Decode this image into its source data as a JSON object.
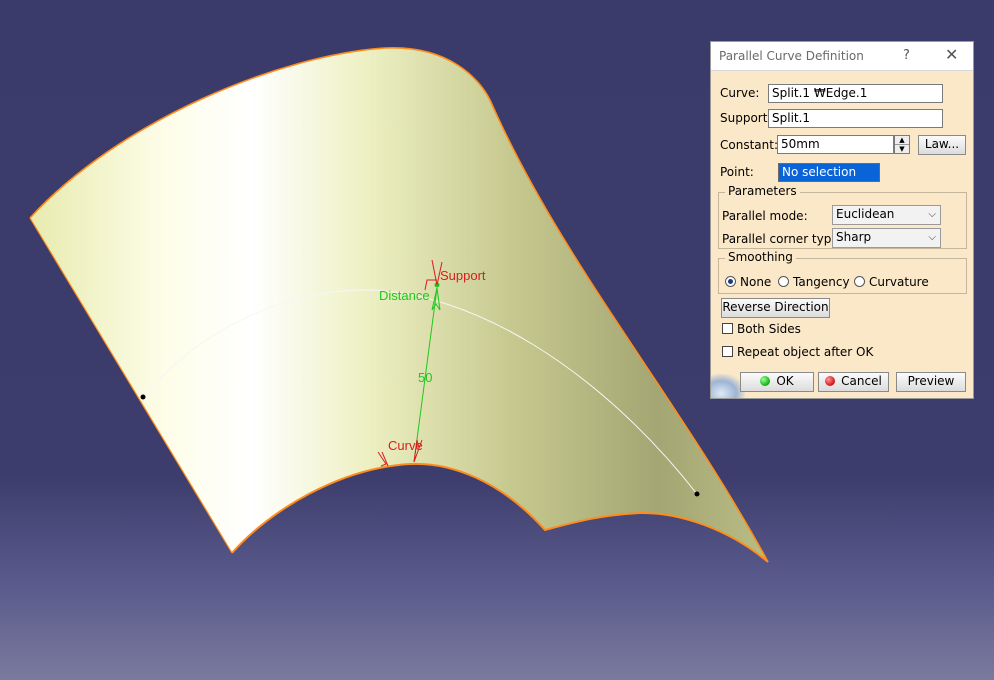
{
  "viewport": {
    "labels": {
      "support": "Support",
      "distance": "Distance",
      "value": "50",
      "curve": "Curve"
    },
    "colors": {
      "surface_light": "#ffffff",
      "surface_base": "#e6eab2",
      "surface_dark": "#9c9f6c",
      "edge": "#ff8c1a",
      "dimension": "#1ec81e",
      "manipulator": "#d81e1e",
      "parallel_curve": "#f4f4f4"
    }
  },
  "dialog": {
    "title": "Parallel Curve Definition",
    "help_icon": "?",
    "close_icon": "✕",
    "curve_label": "Curve:",
    "curve_value": "Split.1 ₩Edge.1",
    "support_label": "Support:",
    "support_value": "Split.1",
    "constant_label": "Constant:",
    "constant_value": "50mm",
    "law_button": "Law...",
    "point_label": "Point:",
    "point_value": "No selection",
    "parameters": {
      "title": "Parameters",
      "mode_label": "Parallel mode:",
      "mode_value": "Euclidean",
      "corner_label": "Parallel corner type:",
      "corner_value": "Sharp"
    },
    "smoothing": {
      "title": "Smoothing",
      "options": [
        "None",
        "Tangency",
        "Curvature"
      ],
      "selected": "None"
    },
    "reverse_button": "Reverse Direction",
    "both_sides_label": "Both Sides",
    "repeat_label": "Repeat object after OK",
    "ok_button": "OK",
    "cancel_button": "Cancel",
    "preview_button": "Preview",
    "ok_led_color": "#22bb22",
    "cancel_led_color": "#dd2222"
  }
}
